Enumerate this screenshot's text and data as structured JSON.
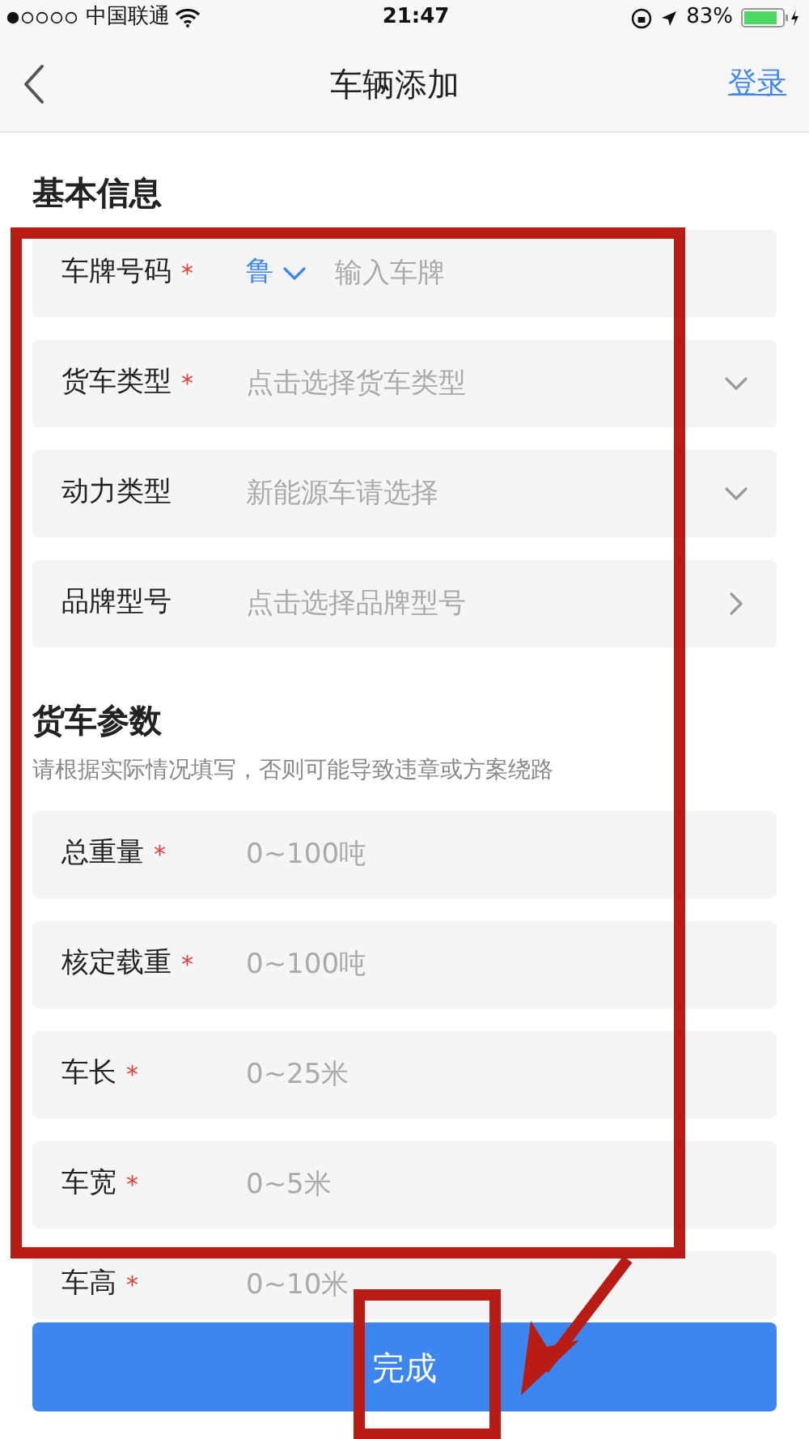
{
  "status_bar": {
    "carrier": "中国联通",
    "time": "21:47",
    "battery": "83%"
  },
  "nav": {
    "title": "车辆添加",
    "action": "登录"
  },
  "sections": [
    {
      "title": "基本信息",
      "fields": [
        {
          "label": "车牌号码",
          "required": true,
          "kind": "plate",
          "prefix": "鲁",
          "placeholder": "输入车牌"
        },
        {
          "label": "货车类型",
          "required": true,
          "kind": "dropdown",
          "placeholder": "点击选择货车类型"
        },
        {
          "label": "动力类型",
          "required": false,
          "kind": "dropdown",
          "placeholder": "新能源车请选择"
        },
        {
          "label": "品牌型号",
          "required": false,
          "kind": "link",
          "placeholder": "点击选择品牌型号"
        }
      ]
    },
    {
      "title": "货车参数",
      "note": "请根据实际情况填写，否则可能导致违章或方案绕路",
      "fields": [
        {
          "label": "总重量",
          "required": true,
          "kind": "text",
          "placeholder": "0~100吨"
        },
        {
          "label": "核定载重",
          "required": true,
          "kind": "text",
          "placeholder": "0~100吨"
        },
        {
          "label": "车长",
          "required": true,
          "kind": "text",
          "placeholder": "0~25米"
        },
        {
          "label": "车宽",
          "required": true,
          "kind": "text",
          "placeholder": "0~5米"
        },
        {
          "label": "车高",
          "required": true,
          "kind": "text",
          "placeholder": "0~10米"
        }
      ]
    }
  ],
  "required_mark": "*",
  "submit": "完成"
}
